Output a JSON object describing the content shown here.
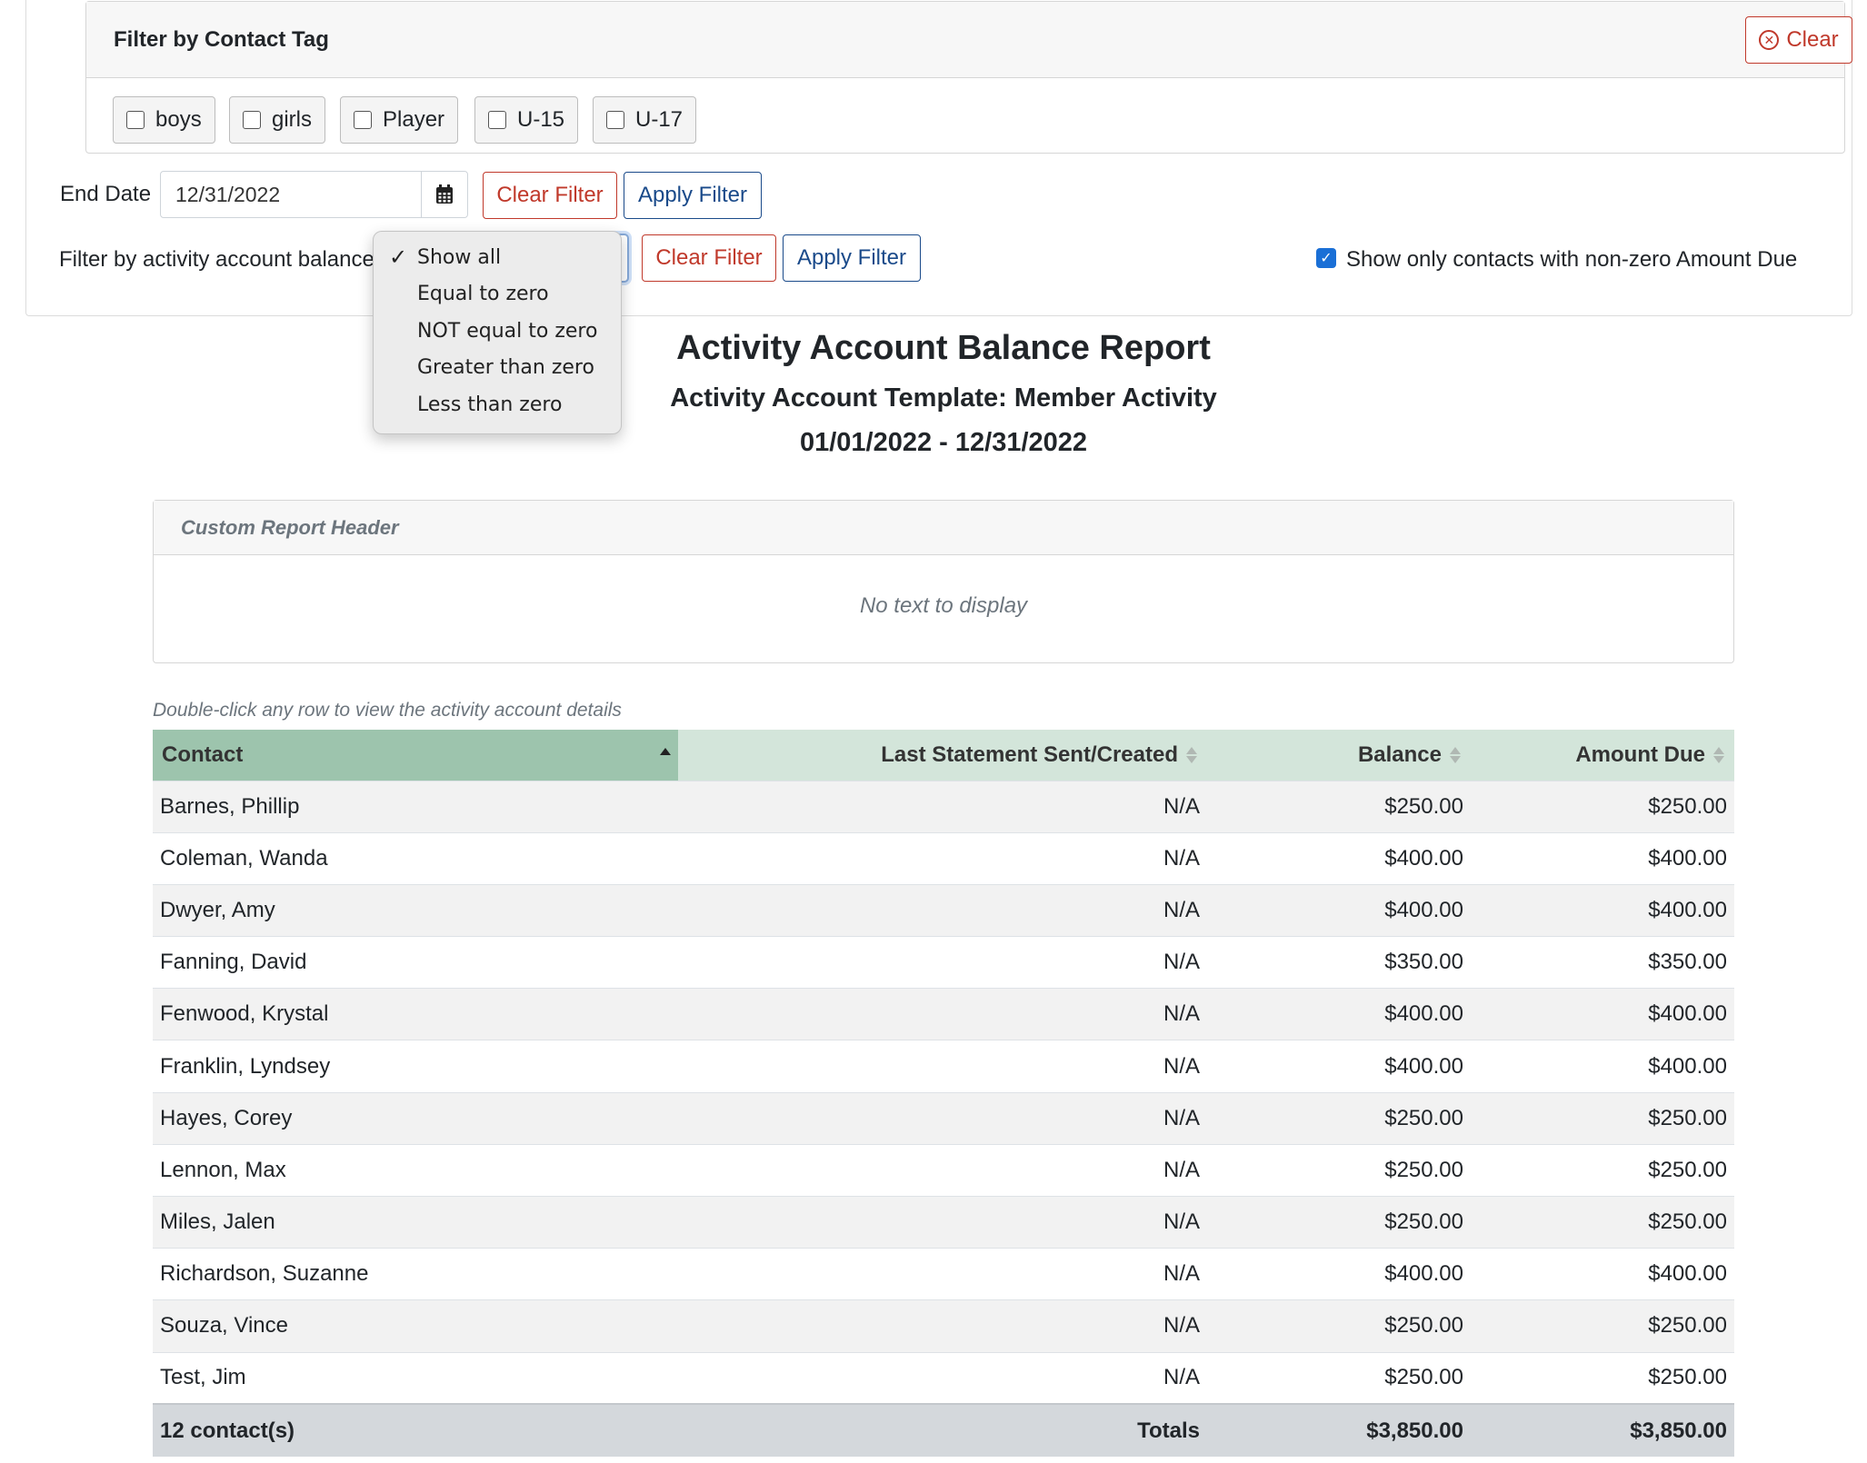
{
  "tag_filter": {
    "title": "Filter by Contact Tag",
    "clear_label": "Clear",
    "tags": [
      "boys",
      "girls",
      "Player",
      "U-15",
      "U-17"
    ]
  },
  "end_date": {
    "label": "End Date",
    "value": "12/31/2022",
    "clear_label": "Clear Filter",
    "apply_label": "Apply Filter"
  },
  "balance_filter": {
    "label": "Filter by activity account balance",
    "selected": "Show all",
    "options": [
      "Show all",
      "Equal to zero",
      "NOT equal to zero",
      "Greater than zero",
      "Less than zero"
    ],
    "clear_label": "Clear Filter",
    "apply_label": "Apply Filter"
  },
  "nonzero_checkbox": {
    "label": "Show only contacts with non-zero Amount Due",
    "checked": true
  },
  "report": {
    "title": "Activity Account Balance Report",
    "template": "Activity Account Template: Member Activity",
    "date_range": "01/01/2022 - 12/31/2022"
  },
  "custom_header": {
    "title": "Custom Report Header",
    "body": "No text to display"
  },
  "table": {
    "hint": "Double-click any row to view the activity account details",
    "columns": [
      "Contact",
      "Last Statement Sent/Created",
      "Balance",
      "Amount Due"
    ],
    "rows": [
      [
        "Barnes, Phillip",
        "N/A",
        "$250.00",
        "$250.00"
      ],
      [
        "Coleman, Wanda",
        "N/A",
        "$400.00",
        "$400.00"
      ],
      [
        "Dwyer, Amy",
        "N/A",
        "$400.00",
        "$400.00"
      ],
      [
        "Fanning, David",
        "N/A",
        "$350.00",
        "$350.00"
      ],
      [
        "Fenwood, Krystal",
        "N/A",
        "$400.00",
        "$400.00"
      ],
      [
        "Franklin, Lyndsey",
        "N/A",
        "$400.00",
        "$400.00"
      ],
      [
        "Hayes, Corey",
        "N/A",
        "$250.00",
        "$250.00"
      ],
      [
        "Lennon, Max",
        "N/A",
        "$250.00",
        "$250.00"
      ],
      [
        "Miles, Jalen",
        "N/A",
        "$250.00",
        "$250.00"
      ],
      [
        "Richardson, Suzanne",
        "N/A",
        "$400.00",
        "$400.00"
      ],
      [
        "Souza, Vince",
        "N/A",
        "$250.00",
        "$250.00"
      ],
      [
        "Test, Jim",
        "N/A",
        "$250.00",
        "$250.00"
      ]
    ],
    "footer": {
      "count": "12 contact(s)",
      "totals_label": "Totals",
      "balance_total": "$3,850.00",
      "amount_due_total": "$3,850.00"
    }
  },
  "colors": {
    "danger": "#c0392b",
    "primary": "#1a4a8a",
    "header_sorted": "#9dc4ad",
    "header": "#d3e5da",
    "checkbox": "#1a6fd6"
  },
  "icons": {
    "clear": "circle-x-icon",
    "calendar": "calendar-icon",
    "check": "checkmark-icon",
    "sort": "sort-icon",
    "sort_asc": "sort-ascending-icon"
  }
}
